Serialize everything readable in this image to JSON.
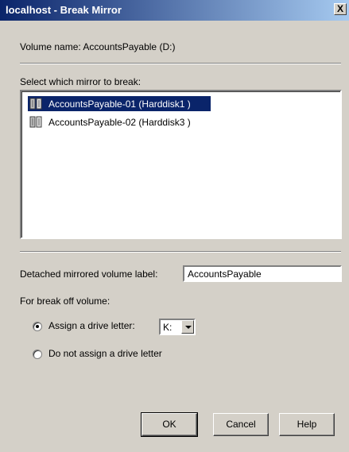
{
  "window": {
    "title": "localhost - Break Mirror",
    "close_glyph": "X"
  },
  "volume": {
    "label": "Volume name: AccountsPayable (D:)"
  },
  "mirror_list": {
    "label": "Select which mirror to break:",
    "items": [
      {
        "label": "AccountsPayable-01 (Harddisk1 )",
        "icon": "mirror-disk-icon",
        "selected": true
      },
      {
        "label": "AccountsPayable-02 (Harddisk3 )",
        "icon": "mirror-disk-icon",
        "selected": false
      }
    ]
  },
  "detached_label": {
    "label": "Detached mirrored volume label:",
    "value": "AccountsPayable"
  },
  "break_off": {
    "label": "For break off volume:",
    "assign_option": {
      "label": "Assign a drive letter:",
      "selected": true
    },
    "drive_letter": "K:",
    "no_assign_option": {
      "label": "Do not assign a drive letter",
      "selected": false
    }
  },
  "buttons": {
    "ok": "OK",
    "cancel": "Cancel",
    "help": "Help"
  },
  "colors": {
    "title_bar": "#0a246a",
    "selection": "#0a246a",
    "dialog_face": "#d4d0c8"
  }
}
